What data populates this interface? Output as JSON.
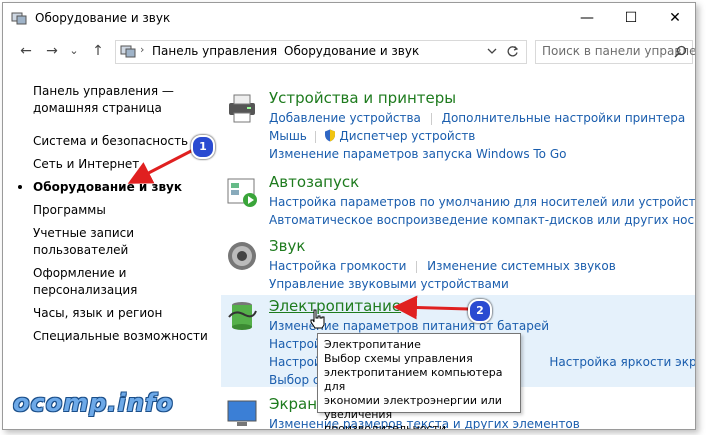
{
  "window": {
    "title": "Оборудование и звук",
    "minimize": "—",
    "maximize": "☐",
    "close": "✕"
  },
  "nav": {
    "back": "←",
    "forward": "→",
    "dropdown": "⌄",
    "up": "↑"
  },
  "address": {
    "crumbs": [
      "Панель управления",
      "Оборудование и звук"
    ],
    "separator": "›"
  },
  "search": {
    "placeholder": "Поиск в панели управле..."
  },
  "sidebar": {
    "items": [
      {
        "label": "Панель управления —"
      },
      {
        "label": "домашняя страница"
      },
      {
        "label": "Система и безопасность"
      },
      {
        "label": "Сеть и Интернет"
      },
      {
        "label": "Оборудование и звук"
      },
      {
        "label": "Программы"
      },
      {
        "label": "Учетные записи"
      },
      {
        "label": "пользователей"
      },
      {
        "label": "Оформление и"
      },
      {
        "label": "персонализация"
      },
      {
        "label": "Часы, язык и регион"
      },
      {
        "label": "Специальные возможности"
      }
    ]
  },
  "categories": {
    "devices": {
      "title": "Устройства и принтеры",
      "l1a": "Добавление устройства",
      "l1b": "Дополнительные настройки принтера",
      "l2a": "Мышь",
      "l2b": "Диспетчер устройств",
      "l3": "Изменение параметров запуска Windows To Go"
    },
    "autoplay": {
      "title": "Автозапуск",
      "l1": "Настройка параметров по умолчанию для носителей или устройств",
      "l2": "Автоматическое воспроизведение компакт-дисков или других носителей"
    },
    "sound": {
      "title": "Звук",
      "l1a": "Настройка громкости",
      "l1b": "Изменение системных звуков",
      "l2": "Управление звуковыми устройствами"
    },
    "power": {
      "title": "Электропитание",
      "l1": "Изменение параметров питания от батарей",
      "l2": "Настрой",
      "l3a": "Настрой",
      "l3b": "Настройка яркости экрана",
      "l4": "Выбор с"
    },
    "screen": {
      "title": "Экран",
      "l1": "Изменение размеров текста и других элементов"
    }
  },
  "tooltip": {
    "title": "Электропитание",
    "body": [
      "Выбор схемы управления",
      "электропитанием компьютера для",
      "экономии электроэнергии или",
      "увеличения производительности."
    ]
  },
  "annotations": {
    "badge1": "1",
    "badge2": "2"
  },
  "watermark": "ocomp.info",
  "colors": {
    "link": "#1a5dad",
    "heading": "#1e7b1e",
    "arrow": "#e02020",
    "badge": "#2a4bd1",
    "hover": "#e5f1fb"
  }
}
